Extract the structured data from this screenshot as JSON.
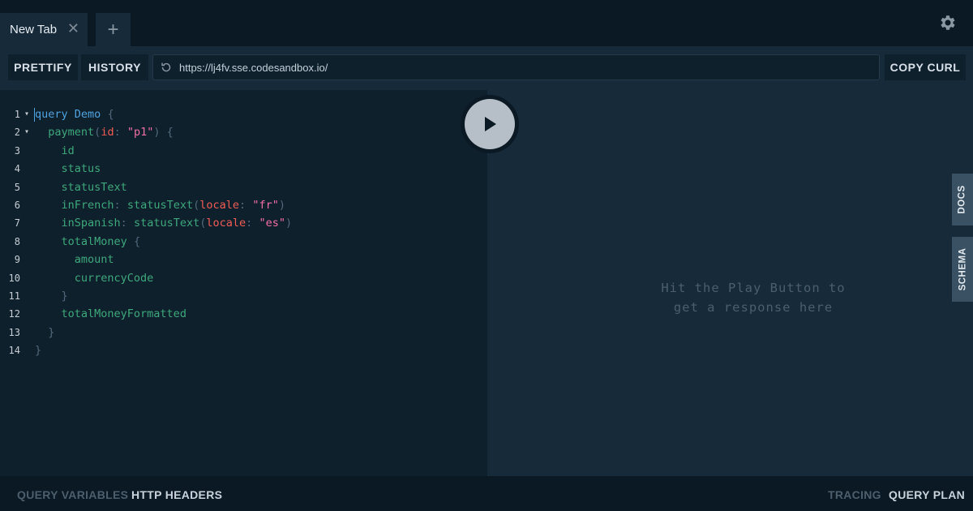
{
  "tabs": {
    "active_label": "New Tab",
    "close_glyph": "✕",
    "add_glyph": "+"
  },
  "toolbar": {
    "prettify_label": "PRETTIFY",
    "history_label": "HISTORY",
    "url": "https://lj4fv.sse.codesandbox.io/",
    "copy_curl_label": "COPY CURL"
  },
  "editor": {
    "line_numbers": [
      "1",
      "2",
      "3",
      "4",
      "5",
      "6",
      "7",
      "8",
      "9",
      "10",
      "11",
      "12",
      "13",
      "14"
    ]
  },
  "response": {
    "hint_line1": "Hit the Play Button to",
    "hint_line2": "get a response here"
  },
  "side_tabs": {
    "docs_label": "DOCS",
    "schema_label": "SCHEMA"
  },
  "bottom_bar": {
    "query_variables_label": "QUERY VARIABLES",
    "http_headers_label": "HTTP HEADERS",
    "tracing_label": "TRACING",
    "query_plan_label": "QUERY PLAN"
  },
  "icons": {
    "settings": "gear-icon",
    "reload": "reload-icon",
    "play": "play-icon"
  },
  "colors": {
    "background": "#0b1924",
    "panel": "#172a3a",
    "editor": "#0f202d",
    "keyword": "#4fa3df",
    "field": "#3ea87c",
    "argument": "#f25c54",
    "string": "#f26ea6"
  }
}
